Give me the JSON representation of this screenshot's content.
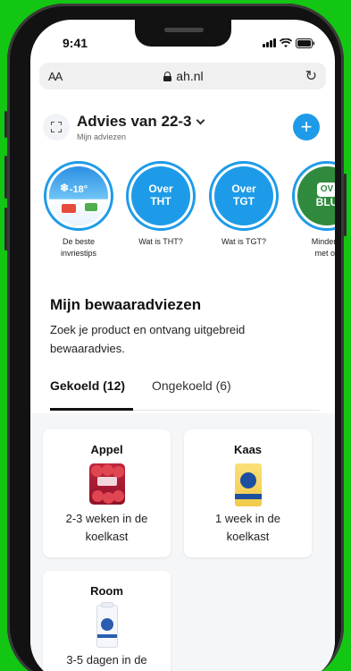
{
  "status": {
    "time": "9:41"
  },
  "browser": {
    "text_size": "AA",
    "url": "ah.nl"
  },
  "header": {
    "title": "Advies van 22-3",
    "subtitle": "Mijn adviezen"
  },
  "stories": [
    {
      "badge": "-18°",
      "label_1": "De beste",
      "label_2": "invriestips"
    },
    {
      "line1": "Over",
      "line2": "THT",
      "label_1": "Wat is THT?",
      "label_2": ""
    },
    {
      "line1": "Over",
      "line2": "TGT",
      "label_1": "Wat is TGT?",
      "label_2": ""
    },
    {
      "line1": "OV",
      "line2": "BLU",
      "label_1": "Minder v",
      "label_2": "met ov"
    }
  ],
  "section": {
    "title": "Mijn bewaaradviezen",
    "description": "Zoek je product en ontvang uitgebreid bewaaradvies."
  },
  "tabs": [
    {
      "label": "Gekoeld (12)",
      "active": true
    },
    {
      "label": "Ongekoeld (6)",
      "active": false
    }
  ],
  "products": [
    {
      "name": "Appel",
      "advice_1": "2-3 weken in de",
      "advice_2": "koelkast"
    },
    {
      "name": "Kaas",
      "advice_1": "1 week in de",
      "advice_2": "koelkast"
    },
    {
      "name": "Room",
      "advice_1": "3-5 dagen in de",
      "advice_2": ""
    }
  ],
  "colors": {
    "background": "#13c613",
    "accent": "#1e9be8",
    "phone": "#121212"
  }
}
